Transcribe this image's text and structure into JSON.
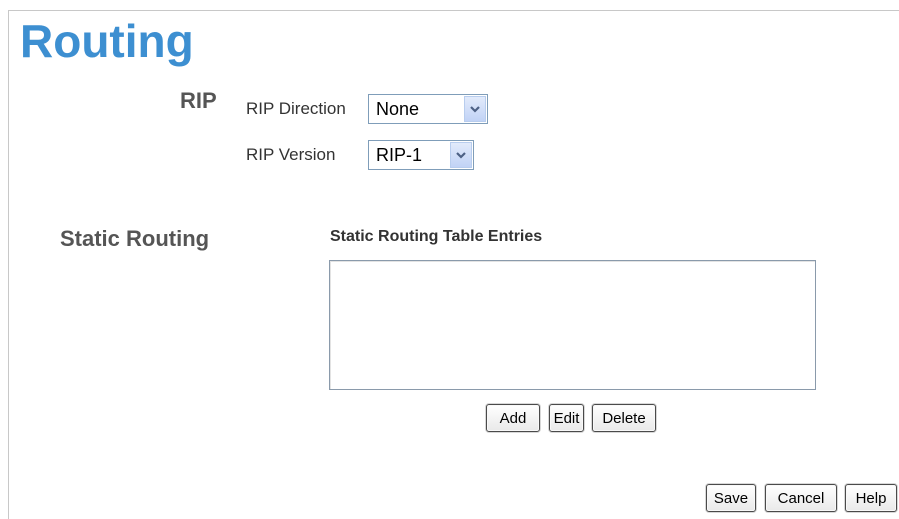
{
  "page": {
    "title": "Routing",
    "accent_color": "#3d8fd1"
  },
  "rip": {
    "heading": "RIP",
    "direction": {
      "label": "RIP Direction",
      "selected": "None",
      "icon": "chevron-down-icon"
    },
    "version": {
      "label": "RIP Version",
      "selected": "RIP-1",
      "icon": "chevron-down-icon"
    }
  },
  "static_routing": {
    "heading": "Static Routing",
    "table_title": "Static Routing Table Entries",
    "entries": [],
    "buttons": {
      "add": "Add",
      "edit": "Edit",
      "delete": "Delete"
    }
  },
  "footer": {
    "save": "Save",
    "cancel": "Cancel",
    "help": "Help"
  }
}
